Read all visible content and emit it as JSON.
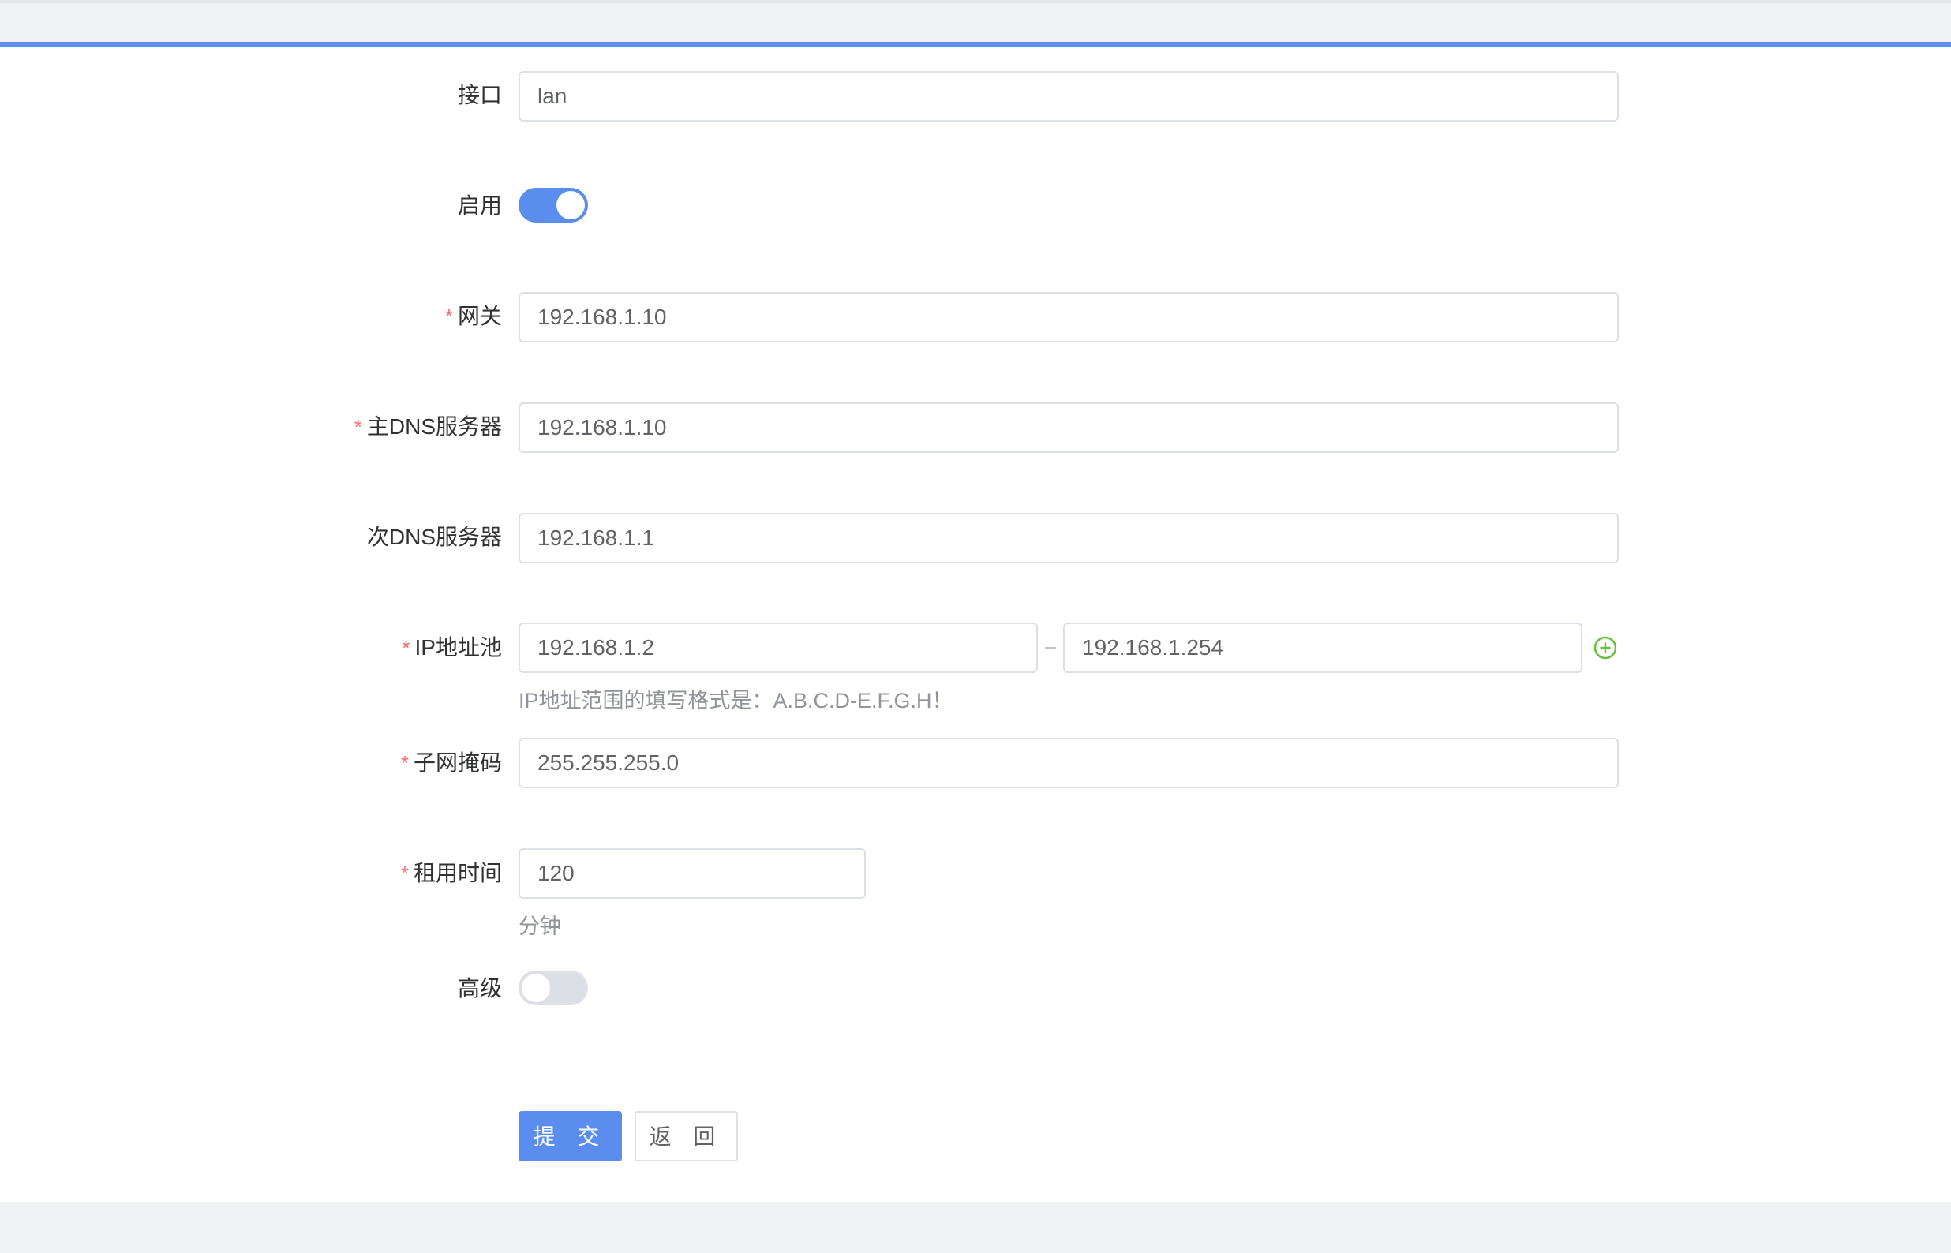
{
  "form": {
    "interface": {
      "label": "接口",
      "value": "lan"
    },
    "enable": {
      "label": "启用",
      "state": "on"
    },
    "gateway": {
      "required_mark": "*",
      "label": "网关",
      "value": "192.168.1.10"
    },
    "primary_dns": {
      "required_mark": "*",
      "label": "主DNS服务器",
      "value": "192.168.1.10"
    },
    "secondary_dns": {
      "label": "次DNS服务器",
      "value": "192.168.1.1"
    },
    "ip_pool": {
      "required_mark": "*",
      "label": "IP地址池",
      "start": "192.168.1.2",
      "end": "192.168.1.254",
      "hint": "IP地址范围的填写格式是：A.B.C.D-E.F.G.H！",
      "add_icon": "plus-circle-icon"
    },
    "subnet_mask": {
      "required_mark": "*",
      "label": "子网掩码",
      "value": "255.255.255.0"
    },
    "lease_time": {
      "required_mark": "*",
      "label": "租用时间",
      "value": "120",
      "unit": "分钟"
    },
    "advanced": {
      "label": "高级",
      "state": "off"
    }
  },
  "actions": {
    "submit_label": "提 交",
    "back_label": "返 回"
  },
  "colors": {
    "accent": "#5b8def",
    "required": "#f56c6c",
    "add_icon": "#67c23a"
  }
}
